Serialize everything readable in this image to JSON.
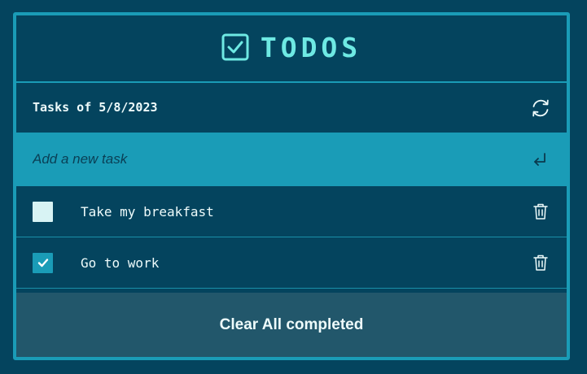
{
  "app": {
    "title": "TODOS"
  },
  "date_row": {
    "text": "Tasks of 5/8/2023"
  },
  "new_task": {
    "placeholder": "Add a new task",
    "value": ""
  },
  "tasks": [
    {
      "label": "Take my breakfast",
      "completed": false
    },
    {
      "label": "Go to work",
      "completed": true
    }
  ],
  "footer": {
    "clear_label": "Clear All completed"
  },
  "icons": {
    "logo": "checkbox-icon",
    "refresh": "refresh-icon",
    "enter": "enter-icon",
    "delete": "trash-icon",
    "checkmark": "checkmark-icon"
  },
  "colors": {
    "background": "#04445e",
    "accent": "#1a9cb7",
    "title": "#6ee9e3",
    "text": "#eefbfb",
    "footer_bg": "#22576b",
    "unchecked_box": "#d8f3f4"
  }
}
